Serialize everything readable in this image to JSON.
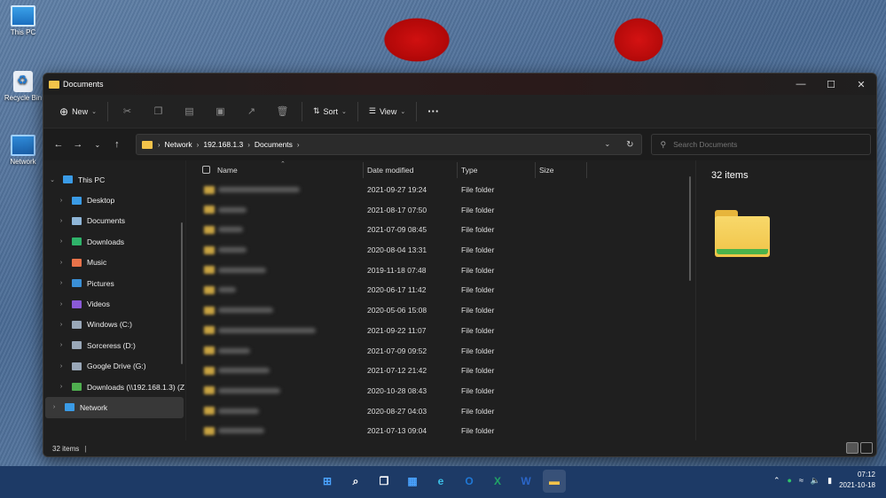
{
  "desktop": {
    "icons": [
      {
        "label": "This PC",
        "icon": "this-pc-icon"
      },
      {
        "label": "Recycle Bin",
        "icon": "recycle-bin-icon"
      },
      {
        "label": "Network",
        "icon": "network-icon"
      }
    ]
  },
  "window": {
    "title": "Documents",
    "controls": [
      "minimize",
      "maximize",
      "close"
    ]
  },
  "toolbar": {
    "new_label": "New",
    "sort_label": "Sort",
    "view_label": "View",
    "more_label": "···"
  },
  "address": {
    "crumbs": [
      "Network",
      "192.168.1.3",
      "Documents"
    ],
    "search_placeholder": "Search Documents"
  },
  "nav": {
    "items": [
      {
        "label": "This PC",
        "icon": "this-pc-icon",
        "color": "#3a9be6"
      },
      {
        "label": "Desktop",
        "icon": "desktop-icon",
        "color": "#3a9be6"
      },
      {
        "label": "Documents",
        "icon": "documents-icon",
        "color": "#8fb6d8"
      },
      {
        "label": "Downloads",
        "icon": "downloads-icon",
        "color": "#2fb36a"
      },
      {
        "label": "Music",
        "icon": "music-icon",
        "color": "#e8734a"
      },
      {
        "label": "Pictures",
        "icon": "pictures-icon",
        "color": "#3a8fd6"
      },
      {
        "label": "Videos",
        "icon": "videos-icon",
        "color": "#8a5ad6"
      },
      {
        "label": "Windows (C:)",
        "icon": "drive-c-icon",
        "color": "#9aa8b8"
      },
      {
        "label": "Sorceress (D:)",
        "icon": "drive-d-icon",
        "color": "#9aa8b8"
      },
      {
        "label": "Google Drive (G:)",
        "icon": "drive-g-icon",
        "color": "#9aa8b8"
      },
      {
        "label": "Downloads (\\\\192.168.1.3) (Z",
        "icon": "network-drive-icon",
        "color": "#4fae4f"
      },
      {
        "label": "Network",
        "icon": "network-icon",
        "color": "#3a9be6"
      }
    ]
  },
  "files": {
    "columns": [
      "Name",
      "Date modified",
      "Type",
      "Size"
    ],
    "rows": [
      {
        "date": "2021-09-27 19:24",
        "type": "File folder"
      },
      {
        "date": "2021-08-17 07:50",
        "type": "File folder"
      },
      {
        "date": "2021-07-09 08:45",
        "type": "File folder"
      },
      {
        "date": "2020-08-04 13:31",
        "type": "File folder"
      },
      {
        "date": "2019-11-18 07:48",
        "type": "File folder"
      },
      {
        "date": "2020-06-17 11:42",
        "type": "File folder"
      },
      {
        "date": "2020-05-06 15:08",
        "type": "File folder"
      },
      {
        "date": "2021-09-22 11:07",
        "type": "File folder"
      },
      {
        "date": "2021-07-09 09:52",
        "type": "File folder"
      },
      {
        "date": "2021-07-12 21:42",
        "type": "File folder"
      },
      {
        "date": "2020-10-28 08:43",
        "type": "File folder"
      },
      {
        "date": "2020-08-27 04:03",
        "type": "File folder"
      },
      {
        "date": "2021-07-13 09:04",
        "type": "File folder"
      }
    ]
  },
  "preview": {
    "count_text": "32 items"
  },
  "status": {
    "count_text": "32 items"
  },
  "taskbar": {
    "apps": [
      {
        "name": "start-icon",
        "glyph": "⊞",
        "color": "#4aa3ff"
      },
      {
        "name": "search-icon",
        "glyph": "⌕",
        "color": "#ffffff"
      },
      {
        "name": "task-view-icon",
        "glyph": "❐",
        "color": "#ffffff"
      },
      {
        "name": "widgets-icon",
        "glyph": "▦",
        "color": "#4aa3ff"
      },
      {
        "name": "edge-icon",
        "glyph": "e",
        "color": "#3cc0e8"
      },
      {
        "name": "outlook-icon",
        "glyph": "O",
        "color": "#1f78d6"
      },
      {
        "name": "excel-icon",
        "glyph": "X",
        "color": "#21a366"
      },
      {
        "name": "word-icon",
        "glyph": "W",
        "color": "#2b66c8"
      },
      {
        "name": "file-explorer-icon",
        "glyph": "▬",
        "color": "#f3c34a"
      }
    ],
    "time": "07:12",
    "date": "2021-10-18"
  }
}
